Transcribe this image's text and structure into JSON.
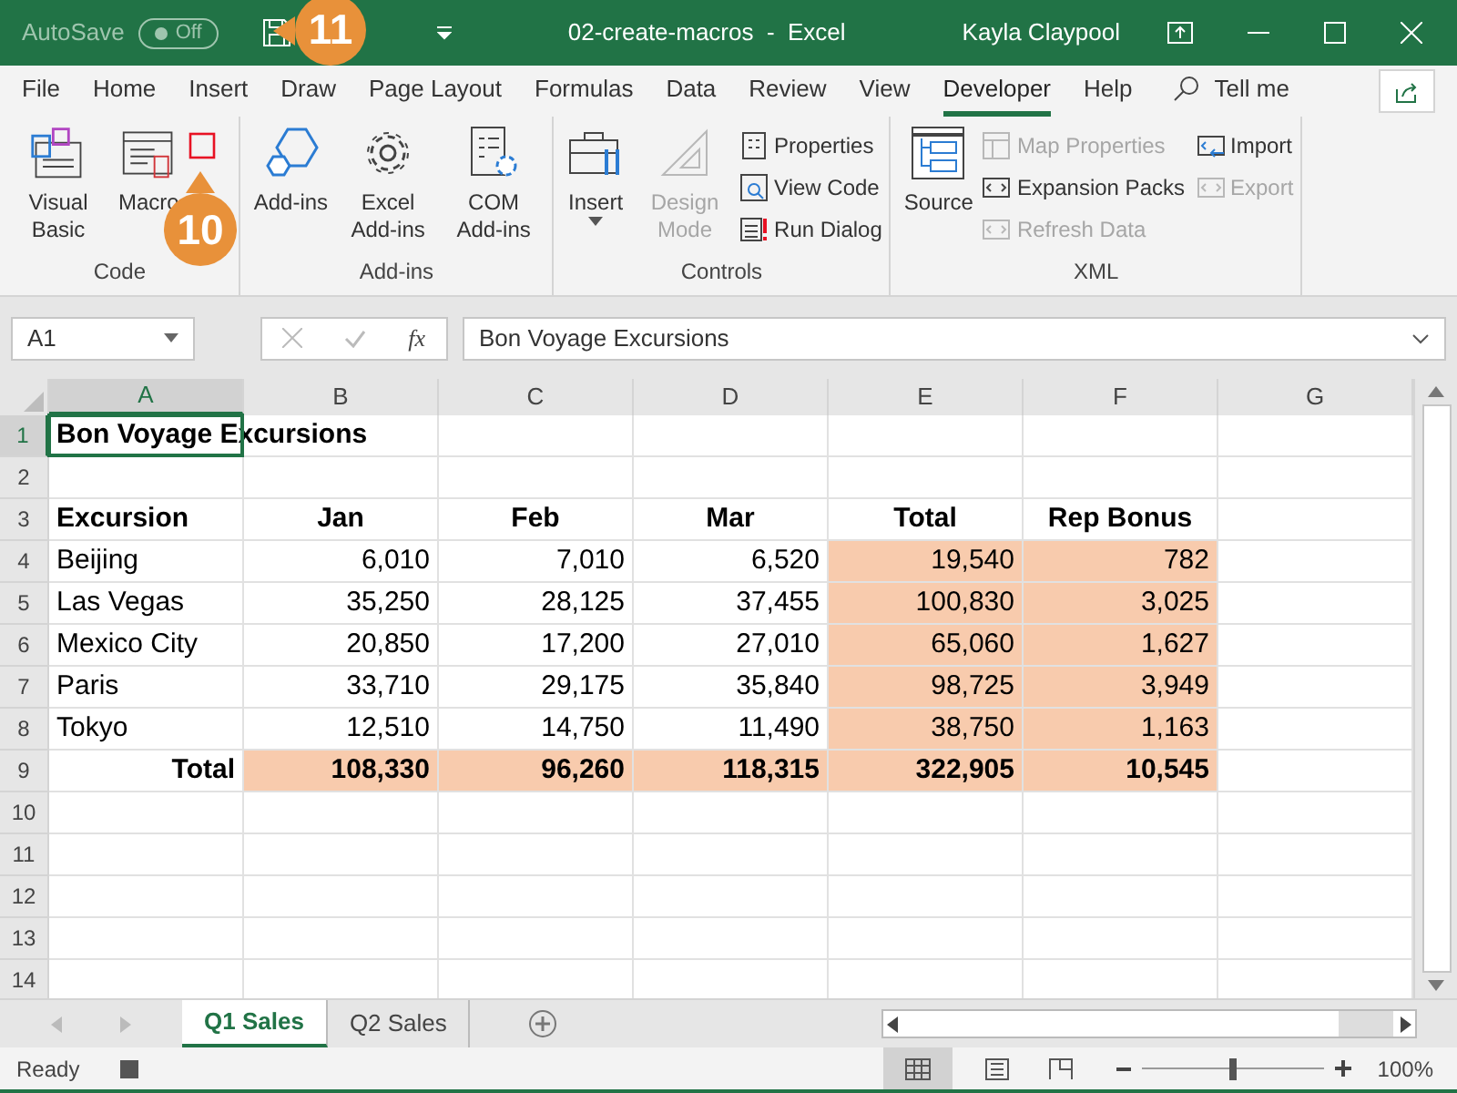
{
  "title_bar": {
    "autosave": {
      "label": "AutoSave",
      "on": false,
      "state": "Off"
    },
    "title": "02-create-macros  -  Excel",
    "user": "Kayla Claypool"
  },
  "callouts": [
    {
      "label": "11",
      "kind": "left"
    },
    {
      "label": "10",
      "kind": "up"
    }
  ],
  "menu_tabs": [
    {
      "label": "File",
      "selected": false
    },
    {
      "label": "Home",
      "selected": false
    },
    {
      "label": "Insert",
      "selected": false
    },
    {
      "label": "Draw",
      "selected": false
    },
    {
      "label": "Page Layout",
      "selected": false
    },
    {
      "label": "Formulas",
      "selected": false
    },
    {
      "label": "Data",
      "selected": false
    },
    {
      "label": "Review",
      "selected": false
    },
    {
      "label": "View",
      "selected": false
    },
    {
      "label": "Developer",
      "selected": true
    },
    {
      "label": "Help",
      "selected": false
    }
  ],
  "search": {
    "placeholder": "Tell me"
  },
  "ribbon": [
    {
      "name": "Code",
      "items": [
        {
          "kind": "large",
          "label": "Visual Basic",
          "disabled": false
        },
        {
          "kind": "large",
          "label": "Macro",
          "disabled": false
        },
        {
          "kind": "record",
          "disabled": false
        }
      ]
    },
    {
      "name": "Add-ins",
      "items": [
        {
          "kind": "large",
          "label": "Add-ins",
          "disabled": false
        },
        {
          "kind": "large",
          "label": "Excel Add-ins",
          "disabled": false
        },
        {
          "kind": "large",
          "label": "COM Add-ins",
          "disabled": false
        }
      ]
    },
    {
      "name": "Controls",
      "items": [
        {
          "kind": "large",
          "label": "Insert",
          "disabled": false,
          "dropdown": true
        },
        {
          "kind": "large",
          "label": "Design Mode",
          "disabled": true
        },
        {
          "kind": "small",
          "label": "Properties",
          "disabled": false
        },
        {
          "kind": "small",
          "label": "View Code",
          "disabled": false
        },
        {
          "kind": "small",
          "label": "Run Dialog",
          "disabled": false
        }
      ]
    },
    {
      "name": "XML",
      "items": [
        {
          "kind": "large",
          "label": "Source",
          "disabled": false
        },
        {
          "kind": "small",
          "label": "Map Properties",
          "disabled": true
        },
        {
          "kind": "small",
          "label": "Expansion Packs",
          "disabled": false
        },
        {
          "kind": "small",
          "label": "Refresh Data",
          "disabled": true
        },
        {
          "kind": "small",
          "label": "Import",
          "disabled": false
        },
        {
          "kind": "small",
          "label": "Export",
          "disabled": true
        }
      ]
    }
  ],
  "formula_bar": {
    "name_box": "A1",
    "function_label": "fx",
    "value": "Bon Voyage Excursions"
  },
  "columns": [
    {
      "label": "A",
      "selected": true
    },
    {
      "label": "B",
      "selected": false
    },
    {
      "label": "C",
      "selected": false
    },
    {
      "label": "D",
      "selected": false
    },
    {
      "label": "E",
      "selected": false
    },
    {
      "label": "F",
      "selected": false
    },
    {
      "label": "G",
      "selected": false
    }
  ],
  "rows": [
    {
      "label": "1",
      "selected": true,
      "cells": [
        {
          "text": "Bon Voyage Excursions",
          "kind": "title",
          "bold": true,
          "highlighted": false
        }
      ]
    },
    {
      "label": "2",
      "selected": false
    },
    {
      "label": "3",
      "selected": false,
      "cells": [
        {
          "text": "Excursion",
          "kind": "label",
          "bold": true,
          "highlighted": false
        },
        {
          "text": "Jan",
          "kind": "heading",
          "bold": true,
          "highlighted": false
        },
        {
          "text": "Feb",
          "kind": "heading",
          "bold": true,
          "highlighted": false
        },
        {
          "text": "Mar",
          "kind": "heading",
          "bold": true,
          "highlighted": false
        },
        {
          "text": "Total",
          "kind": "heading",
          "bold": true,
          "highlighted": false
        },
        {
          "text": "Rep Bonus",
          "kind": "heading",
          "bold": true,
          "highlighted": false
        }
      ]
    },
    {
      "label": "4",
      "selected": false,
      "cells": [
        {
          "text": "Beijing",
          "kind": "label",
          "bold": false,
          "highlighted": false
        },
        {
          "text": "6,010",
          "kind": "number",
          "bold": false,
          "highlighted": false
        },
        {
          "text": "7,010",
          "kind": "number",
          "bold": false,
          "highlighted": false
        },
        {
          "text": "6,520",
          "kind": "number",
          "bold": false,
          "highlighted": false
        },
        {
          "text": "19,540",
          "kind": "number",
          "bold": false,
          "highlighted": true
        },
        {
          "text": "782",
          "kind": "number",
          "bold": false,
          "highlighted": true
        }
      ]
    },
    {
      "label": "5",
      "selected": false,
      "cells": [
        {
          "text": "Las Vegas",
          "kind": "label",
          "bold": false,
          "highlighted": false
        },
        {
          "text": "35,250",
          "kind": "number",
          "bold": false,
          "highlighted": false
        },
        {
          "text": "28,125",
          "kind": "number",
          "bold": false,
          "highlighted": false
        },
        {
          "text": "37,455",
          "kind": "number",
          "bold": false,
          "highlighted": false
        },
        {
          "text": "100,830",
          "kind": "number",
          "bold": false,
          "highlighted": true
        },
        {
          "text": "3,025",
          "kind": "number",
          "bold": false,
          "highlighted": true
        }
      ]
    },
    {
      "label": "6",
      "selected": false,
      "cells": [
        {
          "text": "Mexico City",
          "kind": "label",
          "bold": false,
          "highlighted": false
        },
        {
          "text": "20,850",
          "kind": "number",
          "bold": false,
          "highlighted": false
        },
        {
          "text": "17,200",
          "kind": "number",
          "bold": false,
          "highlighted": false
        },
        {
          "text": "27,010",
          "kind": "number",
          "bold": false,
          "highlighted": false
        },
        {
          "text": "65,060",
          "kind": "number",
          "bold": false,
          "highlighted": true
        },
        {
          "text": "1,627",
          "kind": "number",
          "bold": false,
          "highlighted": true
        }
      ]
    },
    {
      "label": "7",
      "selected": false,
      "cells": [
        {
          "text": "Paris",
          "kind": "label",
          "bold": false,
          "highlighted": false
        },
        {
          "text": "33,710",
          "kind": "number",
          "bold": false,
          "highlighted": false
        },
        {
          "text": "29,175",
          "kind": "number",
          "bold": false,
          "highlighted": false
        },
        {
          "text": "35,840",
          "kind": "number",
          "bold": false,
          "highlighted": false
        },
        {
          "text": "98,725",
          "kind": "number",
          "bold": false,
          "highlighted": true
        },
        {
          "text": "3,949",
          "kind": "number",
          "bold": false,
          "highlighted": true
        }
      ]
    },
    {
      "label": "8",
      "selected": false,
      "cells": [
        {
          "text": "Tokyo",
          "kind": "label",
          "bold": false,
          "highlighted": false
        },
        {
          "text": "12,510",
          "kind": "number",
          "bold": false,
          "highlighted": false
        },
        {
          "text": "14,750",
          "kind": "number",
          "bold": false,
          "highlighted": false
        },
        {
          "text": "11,490",
          "kind": "number",
          "bold": false,
          "highlighted": false
        },
        {
          "text": "38,750",
          "kind": "number",
          "bold": false,
          "highlighted": true
        },
        {
          "text": "1,163",
          "kind": "number",
          "bold": false,
          "highlighted": true
        }
      ]
    },
    {
      "label": "9",
      "selected": false,
      "cells": [
        {
          "text": "Total",
          "kind": "total_label",
          "bold": true,
          "highlighted": false
        },
        {
          "text": "108,330",
          "kind": "number",
          "bold": true,
          "highlighted": true
        },
        {
          "text": "96,260",
          "kind": "number",
          "bold": true,
          "highlighted": true
        },
        {
          "text": "118,315",
          "kind": "number",
          "bold": true,
          "highlighted": true
        },
        {
          "text": "322,905",
          "kind": "number",
          "bold": true,
          "highlighted": true
        },
        {
          "text": "10,545",
          "kind": "number",
          "bold": true,
          "highlighted": true
        }
      ]
    },
    {
      "label": "10",
      "selected": false
    },
    {
      "label": "11",
      "selected": false
    },
    {
      "label": "12",
      "selected": false
    },
    {
      "label": "13",
      "selected": false
    },
    {
      "label": "14",
      "selected": false
    }
  ],
  "sheet_tabs": [
    {
      "label": "Q1 Sales",
      "selected": true
    },
    {
      "label": "Q2 Sales",
      "selected": false
    }
  ],
  "status_bar": {
    "text": "Ready",
    "zoom": {
      "level": 0.5,
      "reading": "100%"
    }
  }
}
